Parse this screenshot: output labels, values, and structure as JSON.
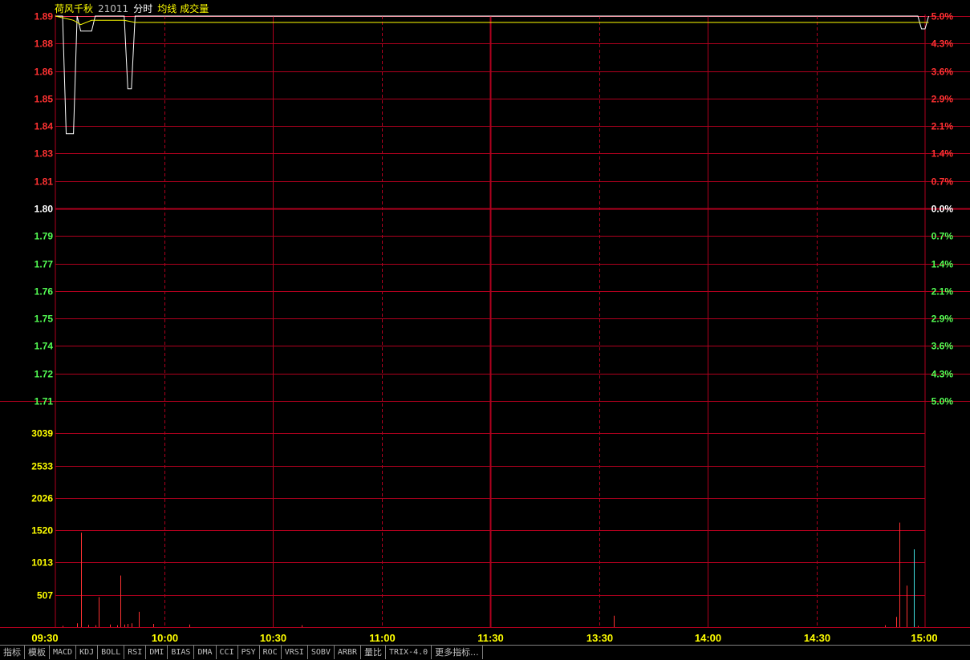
{
  "legend": {
    "stock_name": "荷风千秋",
    "stock_code": "21011",
    "mode": "分时",
    "avg_label": "均线",
    "volume_label": "成交量"
  },
  "colors": {
    "grid": "#b0001e",
    "up": "#ff3232",
    "down": "#54ff54",
    "neutral": "#ffffff",
    "price_line": "#ffffff",
    "avg_line": "#ffff00",
    "volume_axis": "#ffff00",
    "time_axis": "#ffff00",
    "volume_bar": "#ff3232"
  },
  "price_axis": {
    "labels": [
      "1.89",
      "1.88",
      "1.86",
      "1.85",
      "1.84",
      "1.83",
      "1.81",
      "1.80",
      "1.79",
      "1.77",
      "1.76",
      "1.75",
      "1.74",
      "1.72",
      "1.71"
    ],
    "pct_labels": [
      "5.0%",
      "4.3%",
      "3.6%",
      "2.9%",
      "2.1%",
      "1.4%",
      "0.7%",
      "0.0%",
      "0.7%",
      "1.4%",
      "2.1%",
      "2.9%",
      "3.6%",
      "4.3%",
      "5.0%"
    ],
    "max": 1.89,
    "min": 1.71,
    "prev_close": 1.8
  },
  "volume_axis": {
    "labels": [
      "3039",
      "2533",
      "2026",
      "1520",
      "1013",
      "507"
    ],
    "max": 3546
  },
  "time_axis": {
    "labels": [
      "09:30",
      "10:00",
      "10:30",
      "11:00",
      "11:30",
      "13:30",
      "14:00",
      "14:30",
      "15:00"
    ]
  },
  "chart_data": {
    "type": "line",
    "x_range": [
      0,
      240
    ],
    "series": [
      {
        "points": [
          [
            0,
            1.89
          ],
          [
            2,
            1.89
          ],
          [
            3,
            1.835
          ],
          [
            4,
            1.835
          ],
          [
            5,
            1.835
          ],
          [
            6,
            1.89
          ],
          [
            7,
            1.883
          ],
          [
            8,
            1.883
          ],
          [
            9,
            1.883
          ],
          [
            10,
            1.883
          ],
          [
            11,
            1.89
          ],
          [
            19,
            1.89
          ],
          [
            20,
            1.856
          ],
          [
            21,
            1.856
          ],
          [
            22,
            1.89
          ],
          [
            238,
            1.89
          ],
          [
            239,
            1.884
          ],
          [
            240,
            1.884
          ],
          [
            241,
            1.89
          ]
        ]
      },
      {
        "points": [
          [
            0,
            1.89
          ],
          [
            5,
            1.888
          ],
          [
            6,
            1.887
          ],
          [
            7,
            1.886
          ],
          [
            10,
            1.888
          ],
          [
            19,
            1.888
          ],
          [
            22,
            1.887
          ],
          [
            30,
            1.887
          ],
          [
            100,
            1.887
          ],
          [
            200,
            1.887
          ],
          [
            240,
            1.887
          ],
          [
            241,
            1.887
          ]
        ]
      }
    ],
    "volume": [
      [
        2,
        20
      ],
      [
        6,
        60
      ],
      [
        7,
        1480
      ],
      [
        9,
        35
      ],
      [
        11,
        30
      ],
      [
        12,
        470
      ],
      [
        15,
        40
      ],
      [
        17,
        30
      ],
      [
        18,
        810
      ],
      [
        19,
        40
      ],
      [
        20,
        50
      ],
      [
        21,
        60
      ],
      [
        23,
        240
      ],
      [
        27,
        50
      ],
      [
        37,
        40
      ],
      [
        68,
        30
      ],
      [
        154,
        180
      ],
      [
        229,
        30
      ],
      [
        232,
        160
      ],
      [
        233,
        1640
      ],
      [
        235,
        650
      ],
      [
        237,
        1220
      ],
      [
        238,
        20
      ]
    ]
  },
  "toolbar": {
    "tabs": [
      "指标",
      "模板",
      "MACD",
      "KDJ",
      "BOLL",
      "RSI",
      "DMI",
      "BIAS",
      "DMA",
      "CCI",
      "PSY",
      "ROC",
      "VRSI",
      "SOBV",
      "ARBR",
      "量比",
      "TRIX-4.0",
      "更多指标..."
    ]
  }
}
